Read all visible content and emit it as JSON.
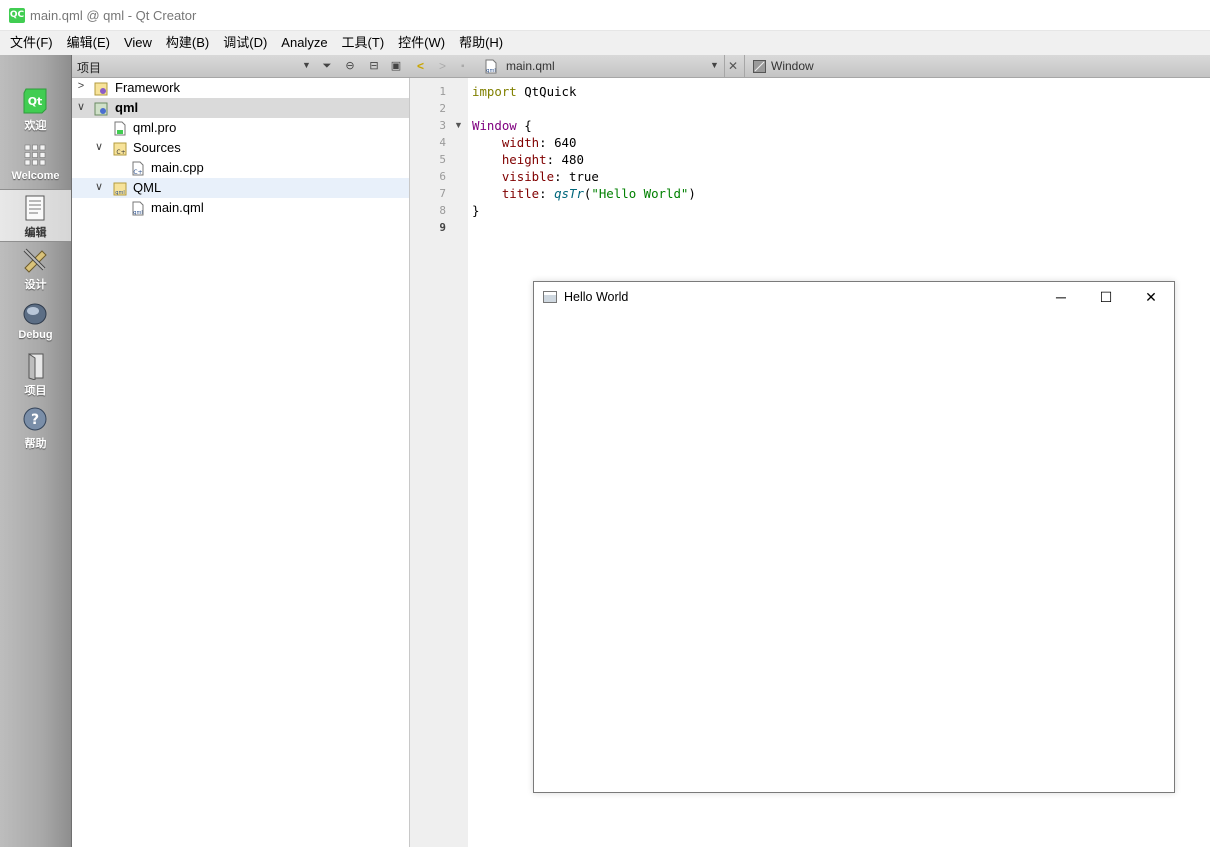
{
  "window": {
    "title": "main.qml @ qml - Qt Creator",
    "app_icon_text": "QC"
  },
  "menu": [
    "文件(F)",
    "编辑(E)",
    "View",
    "构建(B)",
    "调试(D)",
    "Analyze",
    "工具(T)",
    "控件(W)",
    "帮助(H)"
  ],
  "modes": [
    {
      "label": "欢迎",
      "icon": "qt-logo-icon"
    },
    {
      "label": "Welcome",
      "icon": "grid-icon"
    },
    {
      "label": "编辑",
      "icon": "document-icon",
      "active": true
    },
    {
      "label": "设计",
      "icon": "pencil-ruler-icon"
    },
    {
      "label": "Debug",
      "icon": "bug-icon"
    },
    {
      "label": "项目",
      "icon": "folder-icon"
    },
    {
      "label": "帮助",
      "icon": "help-icon"
    }
  ],
  "project_pane": {
    "title": "项目",
    "tree": [
      {
        "label": "Framework",
        "expanded": false
      },
      {
        "label": "qml",
        "expanded": true,
        "selected": true
      },
      {
        "label": "qml.pro"
      },
      {
        "label": "Sources",
        "expanded": true
      },
      {
        "label": "main.cpp"
      },
      {
        "label": "QML",
        "expanded": true
      },
      {
        "label": "main.qml"
      }
    ]
  },
  "editor_bar": {
    "file_name": "main.qml",
    "symbol": "Window"
  },
  "editor": {
    "line_numbers": [
      "1",
      "2",
      "3",
      "4",
      "5",
      "6",
      "7",
      "8",
      "9"
    ],
    "current_line": 9,
    "code": {
      "l1_kw": "import",
      "l1_rest": " QtQuick",
      "l3_type": "Window",
      "l3_rest": " {",
      "l4_prop": "width",
      "l4_rest": ": 640",
      "l5_prop": "height",
      "l5_rest": ": 480",
      "l6_prop": "visible",
      "l6_rest": ": true",
      "l7_prop": "title",
      "l7_colon": ": ",
      "l7_fn": "qsTr",
      "l7_open": "(",
      "l7_str": "\"Hello World\"",
      "l7_close": ")",
      "l8": "}"
    }
  },
  "hello_window": {
    "title": "Hello World",
    "minimize": "─",
    "maximize": "☐",
    "close": "✕"
  }
}
